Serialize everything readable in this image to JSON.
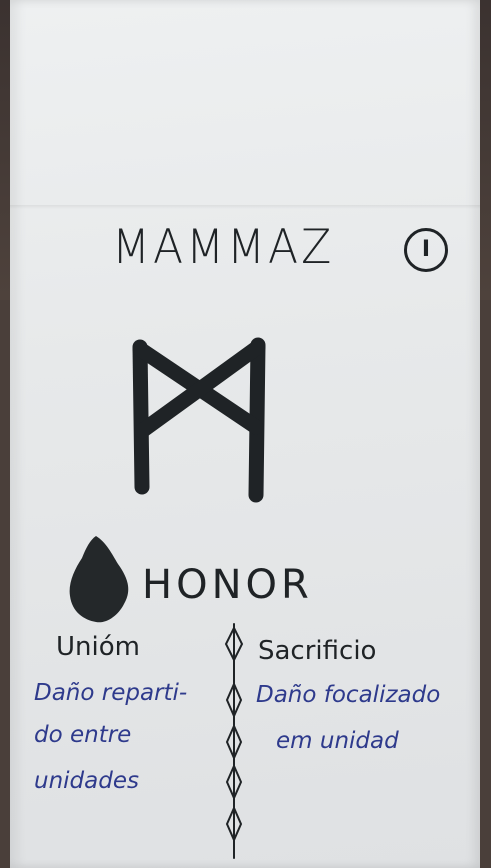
{
  "card": {
    "title": "MAMMAZ",
    "numeral": "I",
    "value_word": "HONOR",
    "left_column": {
      "heading": "Unióm",
      "lines": [
        "Daño reparti-",
        "do entre",
        "unidades"
      ]
    },
    "right_column": {
      "heading": "Sacrificio",
      "lines": [
        "Daño focalizado",
        "em unidad"
      ]
    }
  },
  "icons": {
    "rune": "mannaz-rune-icon",
    "blob": "ink-blob-icon",
    "divider": "divider-vine-icon"
  },
  "colors": {
    "ink_black": "#1f2326",
    "ink_blue": "#2e3a8c",
    "paper": "#e9ebec"
  }
}
